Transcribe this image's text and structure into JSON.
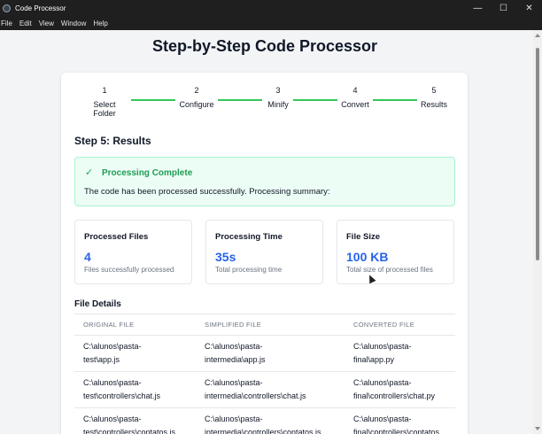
{
  "window": {
    "title": "Code Processor",
    "controls": {
      "minimize": "—",
      "maximize": "☐",
      "close": "✕"
    }
  },
  "menu": [
    "File",
    "Edit",
    "View",
    "Window",
    "Help"
  ],
  "page": {
    "title": "Step-by-Step Code Processor"
  },
  "steps": [
    {
      "num": "1",
      "label": "Select Folder"
    },
    {
      "num": "2",
      "label": "Configure"
    },
    {
      "num": "3",
      "label": "Minify"
    },
    {
      "num": "4",
      "label": "Convert"
    },
    {
      "num": "5",
      "label": "Results"
    }
  ],
  "colors": {
    "step_line": "#34c759",
    "accent": "#2563eb",
    "success": "#1f9d55"
  },
  "section": {
    "title": "Step 5: Results"
  },
  "success": {
    "icon": "check-icon",
    "heading": "Processing Complete",
    "message": "The code has been processed successfully. Processing summary:"
  },
  "stats": [
    {
      "label": "Processed Files",
      "value": "4",
      "desc": "Files successfully processed"
    },
    {
      "label": "Processing Time",
      "value": "35s",
      "desc": "Total processing time"
    },
    {
      "label": "File Size",
      "value": "100 KB",
      "desc": "Total size of processed files"
    }
  ],
  "details": {
    "title": "File Details",
    "columns": [
      "ORIGINAL FILE",
      "SIMPLIFIED FILE",
      "CONVERTED FILE"
    ],
    "rows": [
      [
        "C:\\alunos\\pasta-\ntest\\app.js",
        "C:\\alunos\\pasta-\nintermedia\\app.js",
        "C:\\alunos\\pasta-\nfinal\\app.py"
      ],
      [
        "C:\\alunos\\pasta-\ntest\\controllers\\chat.js",
        "C:\\alunos\\pasta-\nintermedia\\controllers\\chat.js",
        "C:\\alunos\\pasta-\nfinal\\controllers\\chat.py"
      ],
      [
        "C:\\alunos\\pasta-\ntest\\controllers\\contatos.js",
        "C:\\alunos\\pasta-\nintermedia\\controllers\\contatos.js",
        "C:\\alunos\\pasta-\nfinal\\controllers\\contatos"
      ]
    ]
  }
}
